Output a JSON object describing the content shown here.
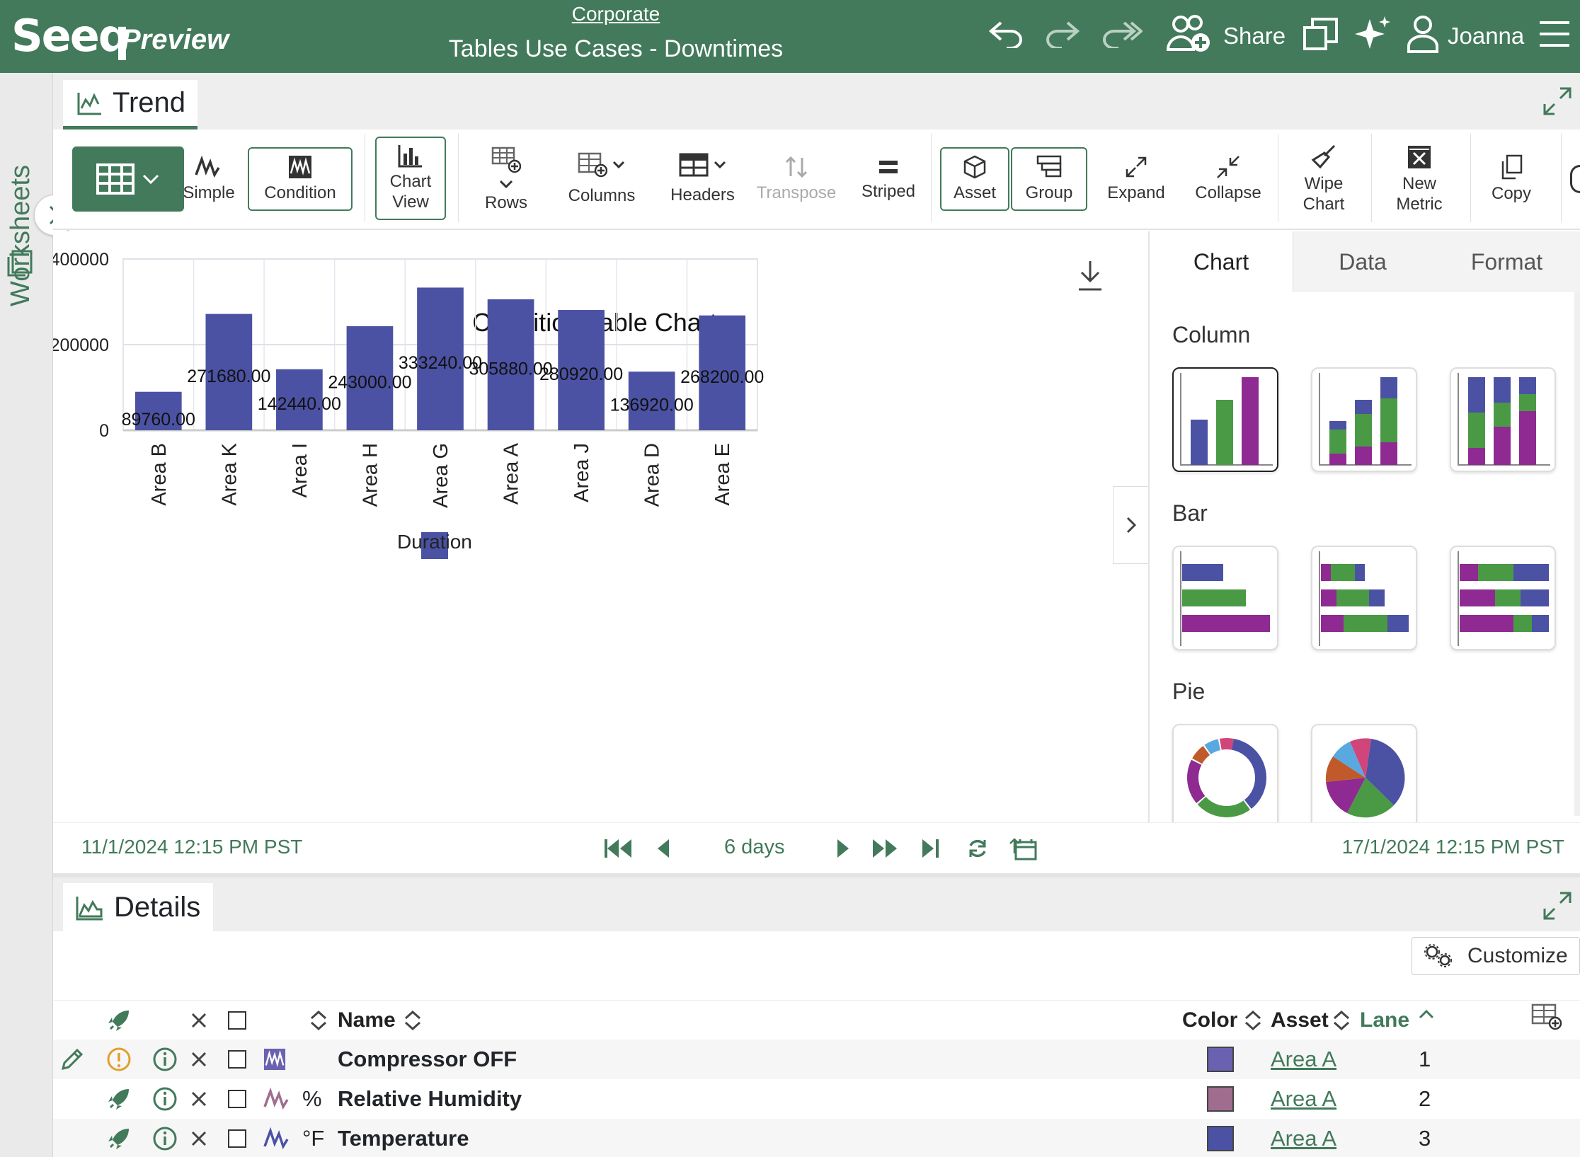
{
  "header": {
    "logo": "Seeq",
    "logo_suffix": "Preview",
    "breadcrumb": "Corporate",
    "title": "Tables Use Cases - Downtimes",
    "share_label": "Share",
    "user_name": "Joanna"
  },
  "sidebar": {
    "label": "Worksheets"
  },
  "trend_tab": {
    "label": "Trend"
  },
  "toolbar": {
    "simple": "Simple",
    "condition": "Condition",
    "chart_view": "Chart View",
    "rows": "Rows",
    "columns": "Columns",
    "headers": "Headers",
    "transpose": "Transpose",
    "striped": "Striped",
    "asset": "Asset",
    "group": "Group",
    "expand": "Expand",
    "collapse": "Collapse",
    "wipe_chart": "Wipe Chart",
    "new_metric": "New Metric",
    "copy": "Copy"
  },
  "chart_data": {
    "type": "bar",
    "title": "Condition Table Chart",
    "categories": [
      "Area B",
      "Area K",
      "Area I",
      "Area H",
      "Area G",
      "Area A",
      "Area J",
      "Area D",
      "Area E"
    ],
    "series": [
      {
        "name": "Duration",
        "color": "#4b52a3",
        "values": [
          89760,
          271680,
          142440,
          243000,
          333240,
          305880,
          280920,
          136920,
          268200
        ]
      }
    ],
    "data_labels": [
      "89760.00",
      "271680.00",
      "142440.00",
      "243000.00",
      "333240.00",
      "305880.00",
      "280920.00",
      "136920.00",
      "268200.00"
    ],
    "y_ticks": [
      "0",
      "200000",
      "400000"
    ],
    "ylim": [
      0,
      400000
    ],
    "grid": true,
    "legend_position": "bottom-center"
  },
  "right_panel": {
    "tabs": [
      "Chart",
      "Data",
      "Format"
    ],
    "active_tab": "Chart",
    "sections": [
      "Column",
      "Bar",
      "Pie"
    ]
  },
  "timebar": {
    "start": "11/1/2024 12:15 PM  PST",
    "duration": "6 days",
    "end": "17/1/2024 12:15 PM  PST"
  },
  "details": {
    "tab_label": "Details",
    "customize_label": "Customize",
    "columns": {
      "name": "Name",
      "color": "Color",
      "asset": "Asset",
      "lane": "Lane"
    },
    "rows": [
      {
        "unit": "",
        "name": "Compressor OFF",
        "color": "#6a62b0",
        "asset": "Area A",
        "lane": "1"
      },
      {
        "unit": "%",
        "name": "Relative Humidity",
        "color": "#a06d8e",
        "asset": "Area A",
        "lane": "2"
      },
      {
        "unit": "°F",
        "name": "Temperature",
        "color": "#4b52a3",
        "asset": "Area A",
        "lane": "3"
      }
    ]
  },
  "colors": {
    "brand": "#427a5b",
    "bar": "#4b52a3",
    "green": "#4a9a45",
    "purple": "#8e2a91",
    "orange": "#e0a030"
  }
}
